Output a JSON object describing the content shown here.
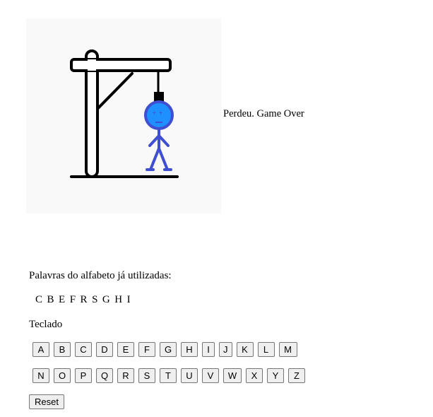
{
  "game": {
    "status": "Perdeu. Game Over"
  },
  "used": {
    "label": "Palavras do alfabeto já utilizadas:",
    "letters": [
      "C",
      "B",
      "E",
      "F",
      "R",
      "S",
      "G",
      "H",
      "I"
    ]
  },
  "keyboard": {
    "label": "Teclado",
    "row1": [
      "A",
      "B",
      "C",
      "D",
      "E",
      "F",
      "G",
      "H",
      "I",
      "J",
      "K",
      "L",
      "M"
    ],
    "row2": [
      "N",
      "O",
      "P",
      "Q",
      "R",
      "S",
      "T",
      "U",
      "V",
      "W",
      "X",
      "Y",
      "Z"
    ]
  },
  "reset_label": "Reset",
  "colors": {
    "figure": "#3f4fcf",
    "face": "#1e90ff",
    "gallows": "#000000"
  }
}
